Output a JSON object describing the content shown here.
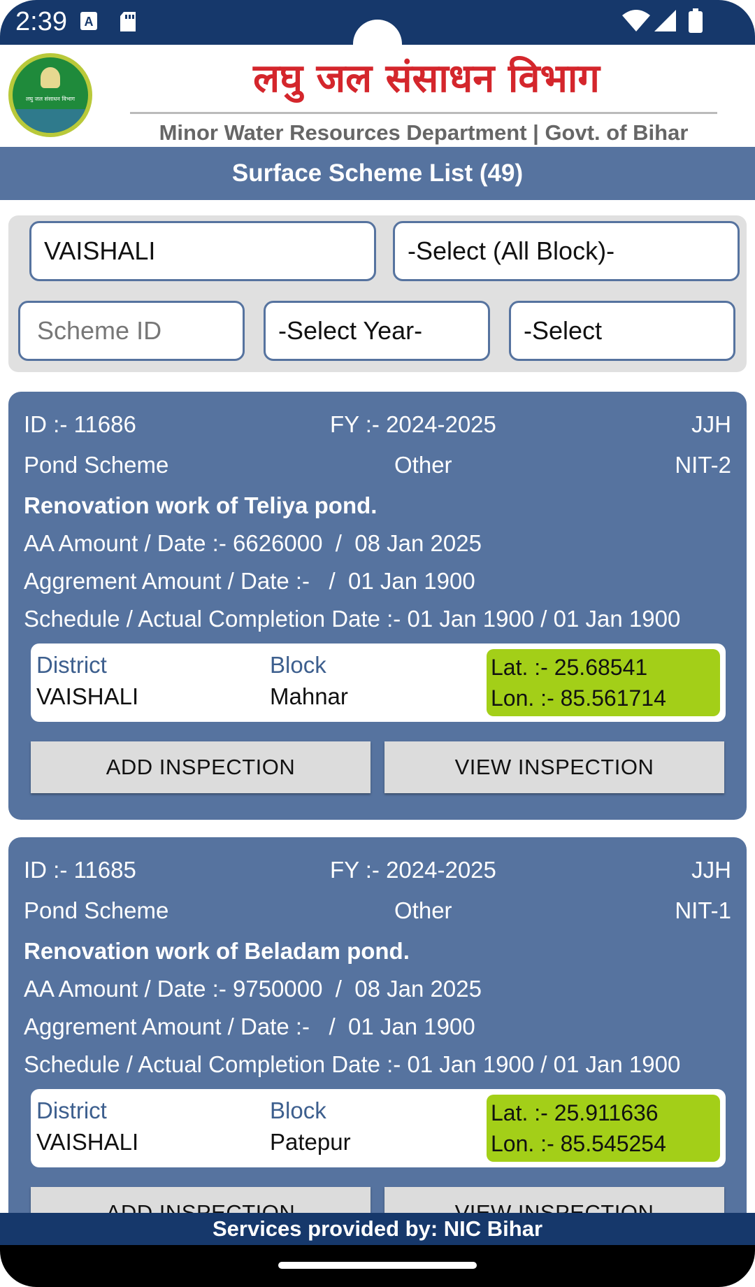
{
  "status_bar": {
    "time": "2:39",
    "icons": [
      "text-notification-icon",
      "sd-card-icon",
      "wifi-icon",
      "signal-icon",
      "battery-icon"
    ]
  },
  "header": {
    "hindi_title": "लघु जल संसाधन विभाग",
    "subtitle": "Minor Water Resources Department | Govt. of Bihar",
    "logo_text": "लघु जल संसाधन विभाग"
  },
  "title_bar": {
    "title": "Surface Scheme List (49)"
  },
  "filters": {
    "district_value": "VAISHALI",
    "block_value": "-Select (All Block)-",
    "scheme_id_placeholder": "Scheme ID",
    "year_value": "-Select Year-",
    "third_value": "-Select"
  },
  "cards": [
    {
      "id": "ID :- 11686",
      "fy": "FY :- 2024-2025",
      "agency": "JJH",
      "scheme_type": "Pond Scheme",
      "category": "Other",
      "nit": "NIT-2",
      "work_name": "Renovation work of Teliya pond.",
      "aa_line": "AA Amount / Date :- 6626000  /  08 Jan 2025",
      "agreement_line": "Aggrement Amount / Date :-   /  01 Jan 1900",
      "schedule_line": "Schedule / Actual Completion Date :- 01 Jan 1900 / 01 Jan 1900",
      "district_label": "District",
      "district": "VAISHALI",
      "block_label": "Block",
      "block": "Mahnar",
      "lat": "Lat. :- 25.68541",
      "lon": "Lon. :- 85.561714",
      "add_btn": "ADD INSPECTION",
      "view_btn": "VIEW INSPECTION"
    },
    {
      "id": "ID :- 11685",
      "fy": "FY :- 2024-2025",
      "agency": "JJH",
      "scheme_type": "Pond Scheme",
      "category": "Other",
      "nit": "NIT-1",
      "work_name": "Renovation work of Beladam pond.",
      "aa_line": "AA Amount / Date :- 9750000  /  08 Jan 2025",
      "agreement_line": "Aggrement Amount / Date :-   /  01 Jan 1900",
      "schedule_line": "Schedule / Actual Completion Date :- 01 Jan 1900 / 01 Jan 1900",
      "district_label": "District",
      "district": "VAISHALI",
      "block_label": "Block",
      "block": "Patepur",
      "lat": "Lat. :- 25.911636",
      "lon": "Lon. :- 85.545254",
      "add_btn": "ADD INSPECTION",
      "view_btn": "VIEW INSPECTION"
    }
  ],
  "footer": {
    "text": "Services provided by: NIC Bihar"
  },
  "colors": {
    "brand_dark": "#16386b",
    "card_blue": "#56739f",
    "title_red": "#d4262c",
    "latlon_green": "#a3cf18"
  }
}
